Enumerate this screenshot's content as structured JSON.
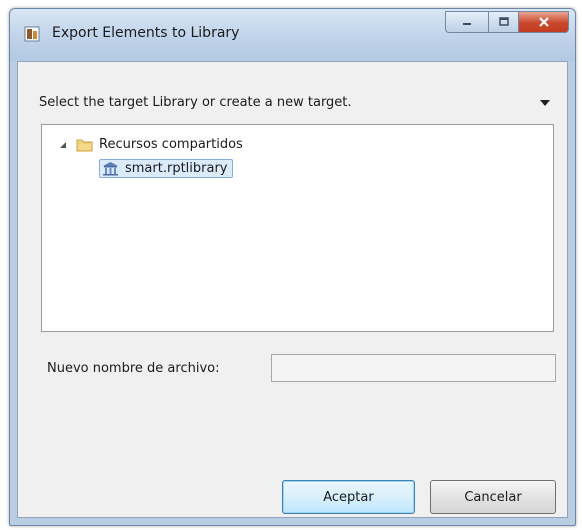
{
  "window": {
    "title": "Export Elements to Library",
    "app_icon": "export-app-icon",
    "controls": {
      "minimize_icon": "minimize-icon",
      "maximize_icon": "maximize-icon",
      "close_icon": "close-icon"
    }
  },
  "dialog": {
    "instruction": "Select the target Library or create a new target.",
    "dropdown_icon": "dropdown-arrow-icon",
    "tree": {
      "root": {
        "label": "Recursos compartidos",
        "icon": "folder-icon",
        "expanded": true
      },
      "child": {
        "label": "smart.rptlibrary",
        "icon": "library-icon",
        "selected": true
      }
    },
    "filename": {
      "label": "Nuevo nombre de archivo:",
      "value": "",
      "placeholder": ""
    },
    "buttons": {
      "accept": "Aceptar",
      "cancel": "Cancelar"
    }
  },
  "colors": {
    "title_bar": "#bfd3ea",
    "close_button": "#c9472d",
    "selection": "#dcebfc",
    "default_button_border": "#3c7fb1"
  }
}
